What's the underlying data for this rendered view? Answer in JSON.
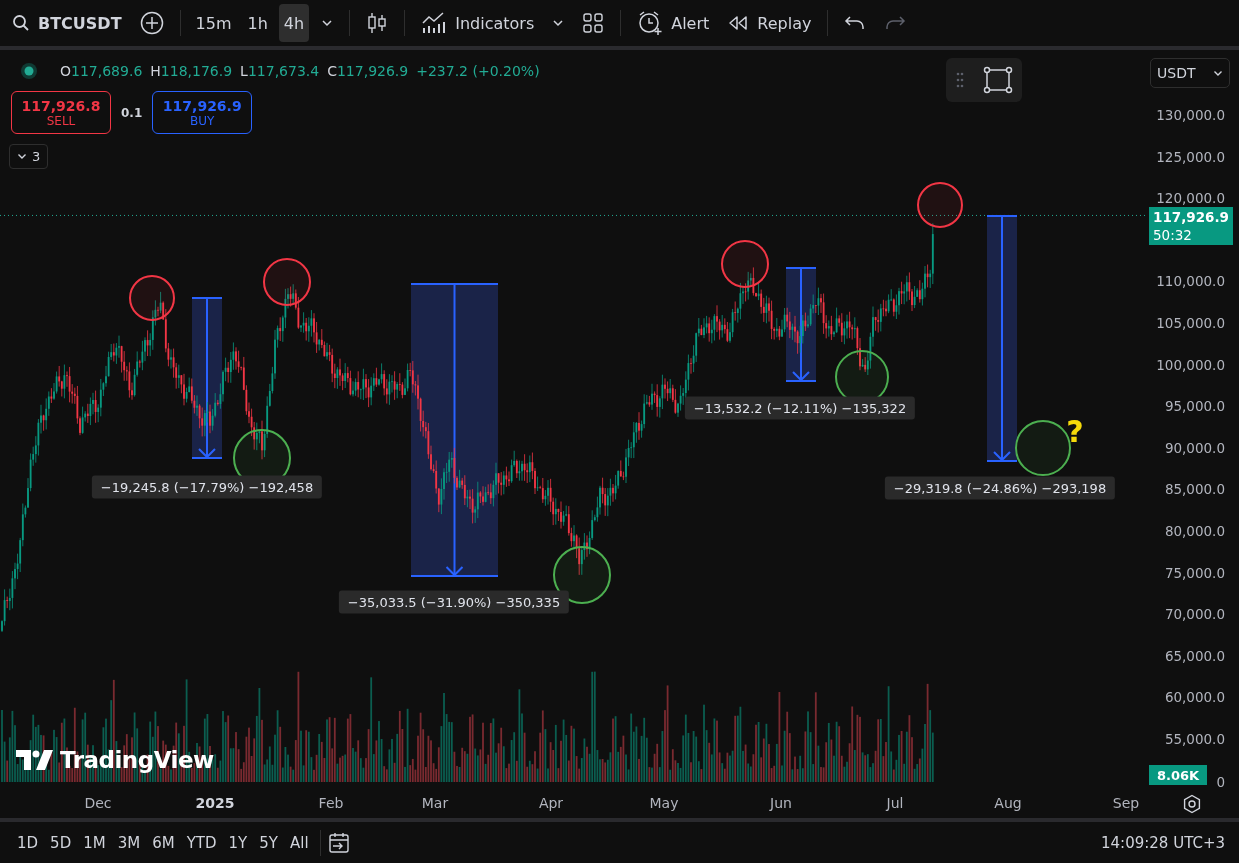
{
  "toolbar": {
    "symbol": "BTCUSDT",
    "intervals": [
      {
        "label": "15m",
        "selected": false
      },
      {
        "label": "1h",
        "selected": false
      },
      {
        "label": "4h",
        "selected": true
      }
    ],
    "indicators": "Indicators",
    "alert": "Alert",
    "replay": "Replay"
  },
  "legend": {
    "open_label": "O",
    "open": "117,689.6",
    "high_label": "H",
    "high": "118,176.9",
    "low_label": "L",
    "low": "117,673.4",
    "close_label": "C",
    "close": "117,926.9",
    "change": "+237.2 (+0.20%)"
  },
  "trade": {
    "sell_price": "117,926.8",
    "sell": "SELL",
    "quantity": "0.1",
    "buy_price": "117,926.9",
    "buy": "BUY"
  },
  "indicators_toggle": "3",
  "logo": "TradingView",
  "currency": "USDT",
  "price_axis": [
    "130,000.0",
    "125,000.0",
    "120,000.0",
    "110,000.0",
    "105,000.0",
    "100,000.0",
    "95,000.0",
    "90,000.0",
    "85,000.0",
    "80,000.0",
    "75,000.0",
    "70,000.0",
    "65,000.0",
    "60,000.0",
    "55,000.0"
  ],
  "volume_axis": "0",
  "last_price": {
    "price": "117,926.9",
    "countdown": "50:32"
  },
  "volume_tag": "8.06K",
  "time_axis": [
    {
      "label": "Dec",
      "kind": "month"
    },
    {
      "label": "2025",
      "kind": "year"
    },
    {
      "label": "Feb",
      "kind": "month"
    },
    {
      "label": "Mar",
      "kind": "month"
    },
    {
      "label": "Apr",
      "kind": "month"
    },
    {
      "label": "May",
      "kind": "month"
    },
    {
      "label": "Jun",
      "kind": "month"
    },
    {
      "label": "Jul",
      "kind": "month"
    },
    {
      "label": "Aug",
      "kind": "month"
    },
    {
      "label": "Sep",
      "kind": "month"
    }
  ],
  "circles": [
    {
      "color": "#f23645"
    },
    {
      "color": "#f23645"
    },
    {
      "color": "#f23645"
    },
    {
      "color": "#f23645"
    },
    {
      "color": "#4caf50"
    },
    {
      "color": "#4caf50"
    },
    {
      "color": "#4caf50"
    },
    {
      "color": "#4caf50"
    }
  ],
  "measures": [
    {
      "label": "−19,245.8 (−17.79%) −192,458"
    },
    {
      "label": "−35,033.5 (−31.90%) −350,335"
    },
    {
      "label": "−13,532.2 (−12.11%) −135,322"
    },
    {
      "label": "−29,319.8 (−24.86%) −293,198"
    }
  ],
  "question_mark": "?",
  "ranges": [
    "1D",
    "5D",
    "1M",
    "3M",
    "6M",
    "YTD",
    "1Y",
    "5Y",
    "All"
  ],
  "clock": "14:09:28 UTC+3"
}
